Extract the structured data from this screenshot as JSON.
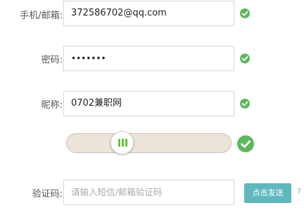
{
  "phone_email": {
    "label": "手机/邮箱:",
    "value": "372586702@qq.com"
  },
  "password": {
    "label": "密码:",
    "value": "•••••••"
  },
  "nickname": {
    "label": "昵称:",
    "value": "0702兼职网"
  },
  "slider": {
    "position_fraction": 0.31
  },
  "captcha": {
    "label": "验证码:",
    "placeholder": "请输入短信/邮箱验证码",
    "send_button_label": "点击发送",
    "edge_text": "?"
  },
  "colors": {
    "check_green": "#5cb85c",
    "knob_bars_green": "#6abf3c",
    "send_button_bg": "#5eb8bd",
    "slider_track_bg": "#ece4d9"
  },
  "icons": {
    "valid": "check-circle-icon",
    "slider_handle": "grip-bars-icon"
  }
}
